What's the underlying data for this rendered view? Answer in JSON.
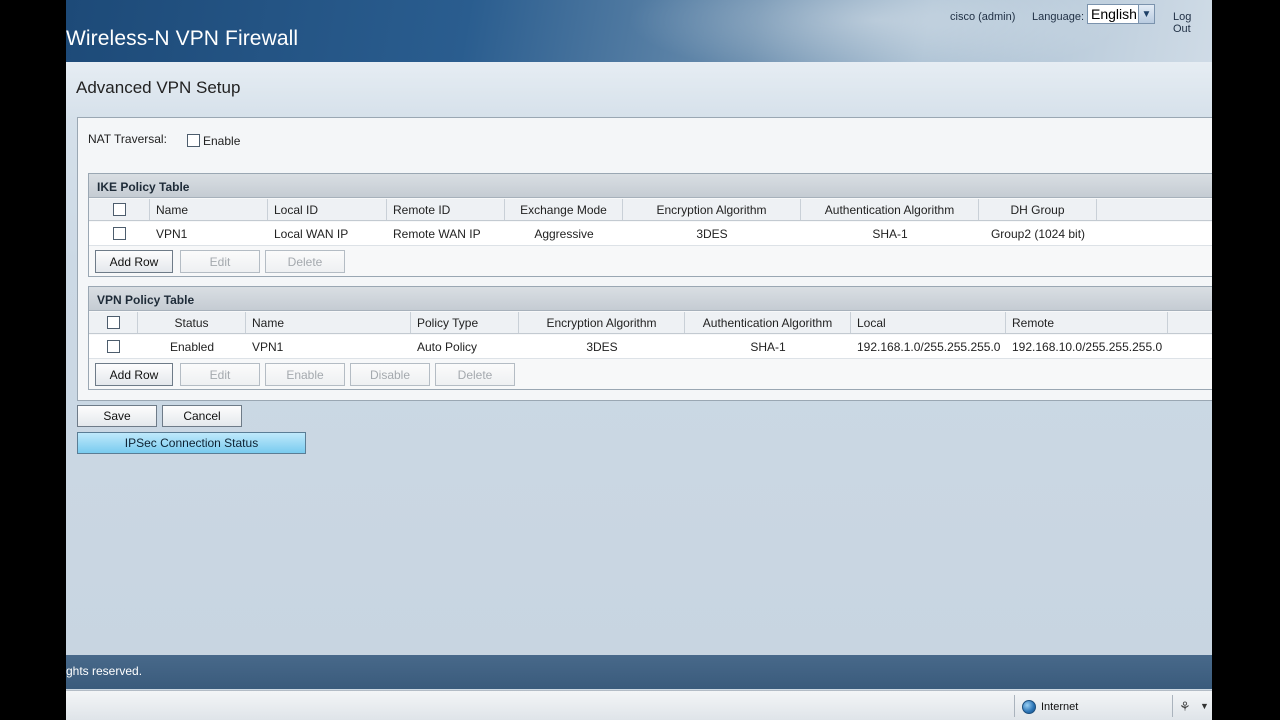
{
  "header": {
    "product_title": "Wireless-N VPN Firewall",
    "user": "cisco (admin)",
    "language_label": "Language:",
    "language_value": "English",
    "logout": "Log Out"
  },
  "page": {
    "title": "Advanced VPN Setup",
    "nat_traversal_label": "NAT Traversal:",
    "nat_enable_label": "Enable",
    "nat_enabled": false
  },
  "ike_table": {
    "title": "IKE Policy Table",
    "columns": [
      "Name",
      "Local ID",
      "Remote ID",
      "Exchange Mode",
      "Encryption Algorithm",
      "Authentication Algorithm",
      "DH Group"
    ],
    "rows": [
      [
        "VPN1",
        "Local WAN IP",
        "Remote WAN IP",
        "Aggressive",
        "3DES",
        "SHA-1",
        "Group2 (1024 bit)"
      ]
    ],
    "buttons": {
      "add_row": "Add Row",
      "edit": "Edit",
      "delete": "Delete"
    }
  },
  "vpn_table": {
    "title": "VPN Policy Table",
    "columns": [
      "Status",
      "Name",
      "Policy Type",
      "Encryption Algorithm",
      "Authentication Algorithm",
      "Local",
      "Remote"
    ],
    "rows": [
      [
        "Enabled",
        "VPN1",
        "Auto Policy",
        "3DES",
        "SHA-1",
        "192.168.1.0/255.255.255.0",
        "192.168.10.0/255.255.255.0"
      ]
    ],
    "buttons": {
      "add_row": "Add Row",
      "edit": "Edit",
      "enable": "Enable",
      "disable": "Disable",
      "delete": "Delete"
    }
  },
  "actions": {
    "save": "Save",
    "cancel": "Cancel",
    "ipsec_status": "IPSec Connection Status"
  },
  "footer": {
    "text": "ghts reserved."
  },
  "statusbar": {
    "zone": "Internet"
  }
}
